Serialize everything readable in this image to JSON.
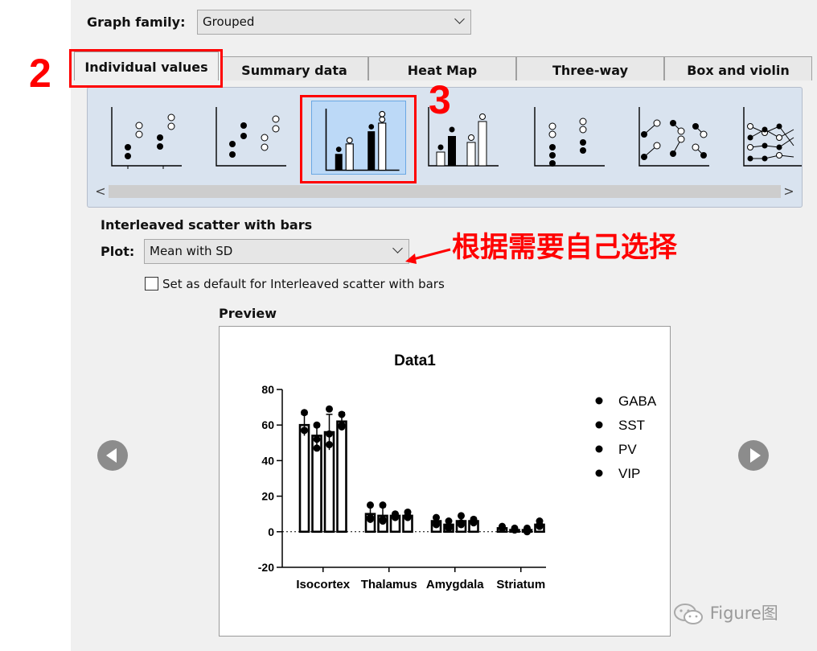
{
  "graph_family": {
    "label": "Graph family:",
    "value": "Grouped"
  },
  "tabs": [
    {
      "label": "Individual values",
      "active": true
    },
    {
      "label": "Summary data"
    },
    {
      "label": "Heat Map"
    },
    {
      "label": "Three-way"
    },
    {
      "label": "Box and violin"
    }
  ],
  "gallery": {
    "thumbnails": [
      "interleaved-scatter",
      "aligned-scatter",
      "interleaved-scatter-with-bars",
      "aligned-scatter-with-bars",
      "stacked-dots",
      "before-after-pairs",
      "multiple-lines"
    ],
    "selected_index": 2,
    "scroll_left": "<",
    "scroll_right": ">"
  },
  "selection": {
    "title": "Interleaved scatter with bars",
    "plot_label": "Plot:",
    "plot_value": "Mean with SD",
    "default_checkbox": "Set as default for Interleaved scatter with bars",
    "default_checked": false
  },
  "preview": {
    "label": "Preview"
  },
  "annotations": {
    "step2": "2",
    "step3": "3",
    "note": "根据需要自己选择",
    "color": "#ff0000"
  },
  "watermark": "Figure图",
  "chart_data": {
    "type": "bar",
    "title": "Data1",
    "categories": [
      "Isocortex",
      "Thalamus",
      "Amygdala",
      "Striatum"
    ],
    "ylim": [
      -20,
      80
    ],
    "yticks": [
      -20,
      0,
      20,
      40,
      60,
      80
    ],
    "legend_position": "right",
    "series": [
      {
        "name": "GABA",
        "values": [
          60,
          10,
          6,
          2
        ],
        "sd": [
          6,
          5,
          2,
          1
        ],
        "points": [
          [
            67,
            57,
            57
          ],
          [
            15,
            8,
            7
          ],
          [
            8,
            5,
            4
          ],
          [
            3,
            2,
            2
          ]
        ]
      },
      {
        "name": "SST",
        "values": [
          54,
          9,
          4,
          1
        ],
        "sd": [
          5,
          5,
          2,
          1
        ],
        "points": [
          [
            60,
            52,
            47
          ],
          [
            15,
            7,
            6
          ],
          [
            6,
            3,
            2
          ],
          [
            2,
            1,
            1
          ]
        ]
      },
      {
        "name": "PV",
        "values": [
          56,
          9,
          6,
          1
        ],
        "sd": [
          10,
          1,
          3,
          1
        ],
        "points": [
          [
            69,
            49,
            55
          ],
          [
            10,
            9,
            8
          ],
          [
            9,
            4,
            5
          ],
          [
            2,
            0,
            1
          ]
        ]
      },
      {
        "name": "VIP",
        "values": [
          62,
          9,
          6,
          4
        ],
        "sd": [
          5,
          2,
          1,
          2
        ],
        "points": [
          [
            66,
            59,
            60
          ],
          [
            11,
            9,
            8
          ],
          [
            7,
            6,
            5
          ],
          [
            6,
            4,
            3
          ]
        ]
      }
    ]
  }
}
